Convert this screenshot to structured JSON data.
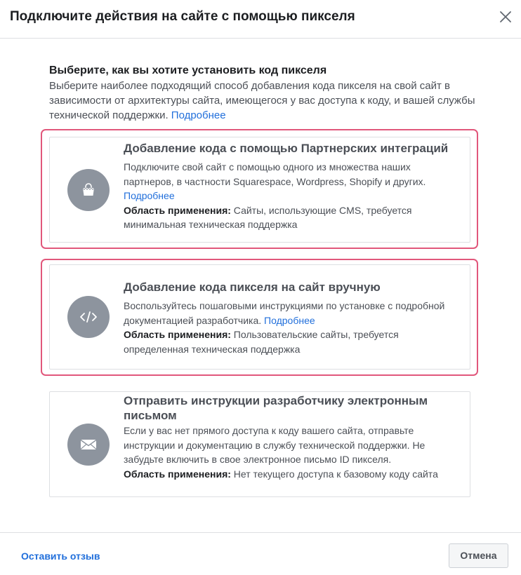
{
  "dialog": {
    "title": "Подключите действия на сайте с помощью пикселя"
  },
  "intro": {
    "heading": "Выберите, как вы хотите установить код пикселя",
    "text": "Выберите наиболее подходящий способ добавления кода пикселя на свой сайт в зависимости от архитектуры сайта, имеющегося у вас доступа к коду, и вашей службы технической поддержки.",
    "link": "Подробнее"
  },
  "options": [
    {
      "icon": "shopping-bag-icon",
      "title": "Добавление кода с помощью Партнерских интеграций",
      "description": "Подключите свой сайт с помощью одного из множества наших партнеров, в частности Squarespace, Wordpress, Shopify и других.",
      "link": "Подробнее",
      "scope_label": "Область применения:",
      "scope_text": "Сайты, использующие CMS, требуется минимальная техническая поддержка"
    },
    {
      "icon": "code-icon",
      "title": "Добавление кода пикселя на сайт вручную",
      "description": "Воспользуйтесь пошаговыми инструкциями по установке с подробной документацией разработчика.",
      "link": "Подробнее",
      "scope_label": "Область применения:",
      "scope_text": "Пользовательские сайты, требуется определенная техническая поддержка"
    },
    {
      "icon": "envelope-icon",
      "title": "Отправить инструкции разработчику электронным письмом",
      "description": "Если у вас нет прямого доступа к коду вашего сайта, отправьте инструкции и документацию в службу технической поддержки. Не забудьте включить в свое электронное письмо ID пикселя.",
      "scope_label": "Область применения:",
      "scope_text": "Нет текущего доступа к базовому коду сайта"
    }
  ],
  "footer": {
    "feedback": "Оставить отзыв",
    "cancel": "Отмена"
  },
  "colors": {
    "highlight": "#e1577b",
    "link": "#216fdb",
    "icon_circle": "#8d949e"
  }
}
